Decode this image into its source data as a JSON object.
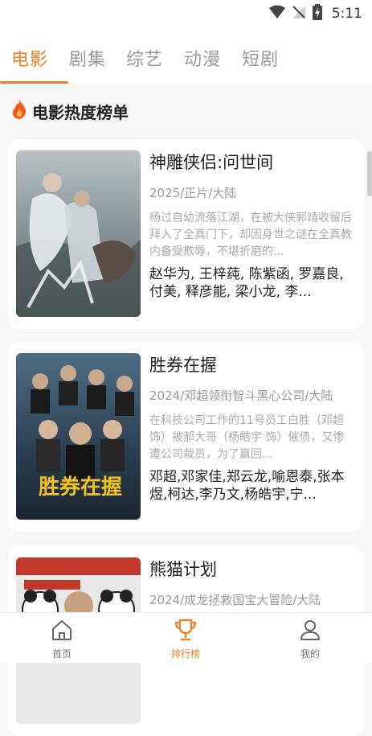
{
  "status_bar": {
    "time": "5:11"
  },
  "tabs": [
    {
      "label": "电影",
      "active": true
    },
    {
      "label": "剧集",
      "active": false
    },
    {
      "label": "综艺",
      "active": false
    },
    {
      "label": "动漫",
      "active": false
    },
    {
      "label": "短剧",
      "active": false
    }
  ],
  "section": {
    "title": "电影热度榜单",
    "icon": "fire-icon"
  },
  "movies": [
    {
      "title": "神雕侠侣:问世间",
      "meta": "2025/正片/大陆",
      "description": "杨过自幼流落江湖，在被大侠郭靖收留后拜入了全真门下，却因身世之谜在全真教内备受欺辱，不堪折磨的...",
      "cast": "赵华为, 王梓莼, 陈紫函, 罗嘉良, 付美, 释彦能, 梁小龙, 李..."
    },
    {
      "title": "胜券在握",
      "meta": "2024/邓超领衔智斗黑心公司/大陆",
      "description": "在科技公司工作的11号员工白胜（邓超 饰）被郝大哥（杨皓宇 饰）催债，又惨遭公司裁员，为了赢回...",
      "cast": "邓超,邓家佳,郑云龙,喻恩泰,张本煜,柯达,李乃文,杨皓宇,宁..."
    },
    {
      "title": "熊猫计划",
      "meta": "2024/成龙拯救国宝大冒险/大陆",
      "description": "",
      "cast": ""
    }
  ],
  "bottom_nav": [
    {
      "label": "首页",
      "icon": "home-icon",
      "active": false
    },
    {
      "label": "排行榜",
      "icon": "trophy-icon",
      "active": true
    },
    {
      "label": "我的",
      "icon": "profile-icon",
      "active": false
    }
  ],
  "colors": {
    "accent": "#f57c1f",
    "background": "#f6f6f6",
    "card": "#ffffff"
  }
}
